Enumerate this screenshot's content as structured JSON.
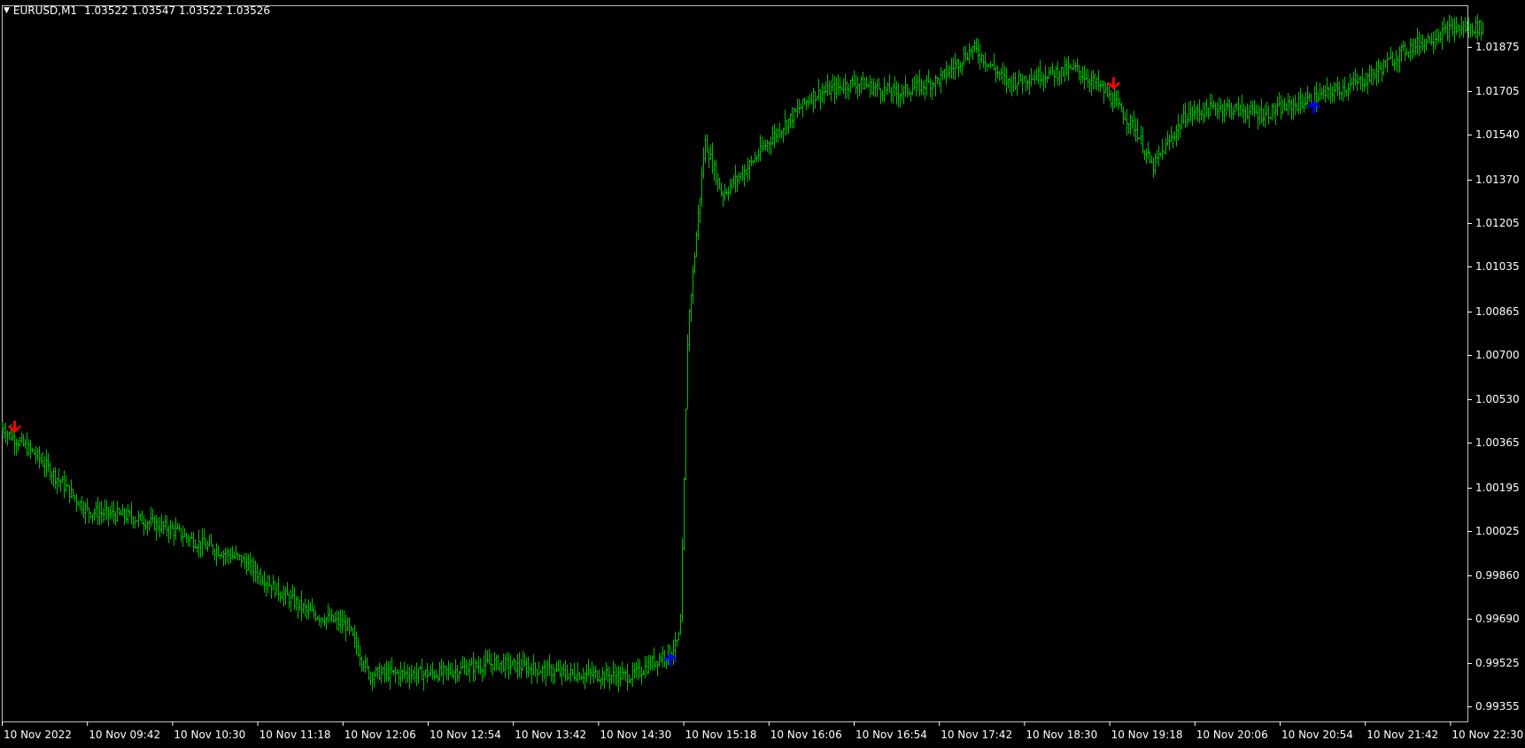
{
  "header": {
    "symbol_tf": "EURUSD,M1",
    "ohlc": "1.03522 1.03547 1.03522 1.03526"
  },
  "colors": {
    "background": "#000000",
    "bars": "#00c000",
    "axis": "#ffffff",
    "sell_arrow": "#ff0000",
    "buy_arrow": "#0000ff"
  },
  "chart_data": {
    "type": "bar",
    "style": "ohlc-bars",
    "grid": false,
    "ylim": [
      0.9927,
      1.0196
    ],
    "y_ticks": [
      "1.01875",
      "1.01705",
      "1.01540",
      "1.01370",
      "1.01205",
      "1.01035",
      "1.00865",
      "1.00700",
      "1.00530",
      "1.00365",
      "1.00195",
      "1.00025",
      "0.99860",
      "0.99690",
      "0.99525",
      "0.99355"
    ],
    "x_ticks": [
      "10 Nov 2022",
      "10 Nov 09:42",
      "10 Nov 10:30",
      "10 Nov 11:18",
      "10 Nov 12:06",
      "10 Nov 12:54",
      "10 Nov 13:42",
      "10 Nov 14:30",
      "10 Nov 15:18",
      "10 Nov 16:06",
      "10 Nov 16:54",
      "10 Nov 17:42",
      "10 Nov 18:30",
      "10 Nov 19:18",
      "10 Nov 20:06",
      "10 Nov 20:54",
      "10 Nov 21:42",
      "10 Nov 22:30"
    ],
    "price_path": {
      "x_tick_index": [
        0,
        0.4,
        1,
        1.5,
        2,
        2.3,
        2.8,
        3.2,
        3.6,
        4.05,
        4.3,
        5.1,
        5.8,
        6.6,
        7.4,
        7.9,
        7.96,
        8.05,
        8.25,
        8.45,
        8.75,
        9.0,
        9.5,
        10.0,
        10.5,
        11.0,
        11.4,
        11.8,
        12.2,
        12.6,
        12.9,
        13.3,
        13.5,
        13.9,
        14.3,
        14.8,
        15.3,
        16.0,
        16.5,
        17.0,
        17.4
      ],
      "close": [
        1.0037,
        1.0027,
        1.0006,
        1.0004,
        0.9999,
        0.9994,
        0.9988,
        0.9977,
        0.9968,
        0.9963,
        0.9945,
        0.9945,
        0.9949,
        0.9945,
        0.9944,
        0.9955,
        0.996,
        1.0075,
        1.0145,
        1.0125,
        1.0135,
        1.0145,
        1.0162,
        1.0167,
        1.0163,
        1.0168,
        1.018,
        1.0167,
        1.017,
        1.0172,
        1.0165,
        1.015,
        1.0135,
        1.0155,
        1.0158,
        1.0155,
        1.016,
        1.0168,
        1.018,
        1.0187,
        1.0188
      ]
    },
    "signals": [
      {
        "type": "sell",
        "x_tick_index": 0.15,
        "price": 1.0036
      },
      {
        "type": "buy",
        "x_tick_index": 7.85,
        "price": 0.9952
      },
      {
        "type": "sell",
        "x_tick_index": 13.05,
        "price": 1.0165
      },
      {
        "type": "buy",
        "x_tick_index": 15.4,
        "price": 1.01595
      }
    ]
  }
}
